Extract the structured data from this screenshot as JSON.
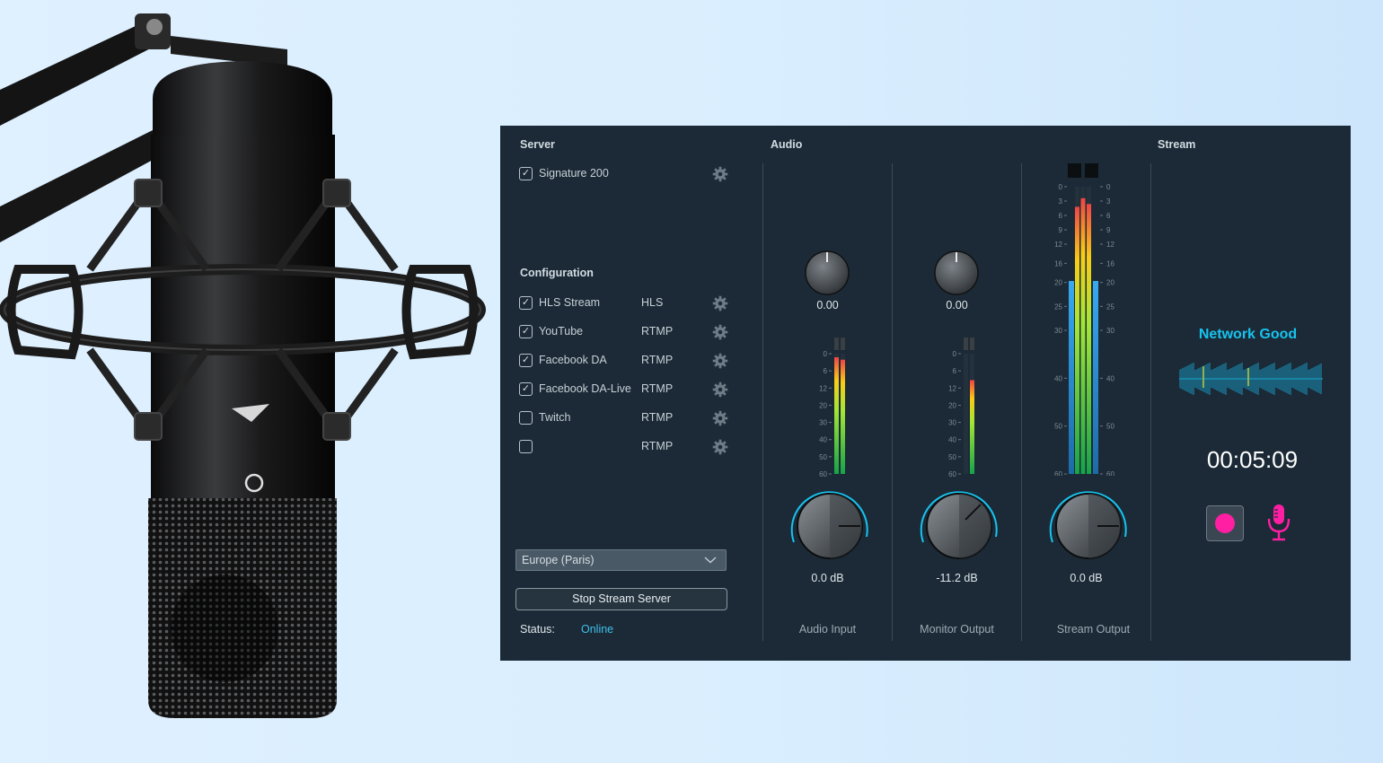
{
  "panel": {
    "sections": {
      "server": "Server",
      "audio": "Audio",
      "stream": "Stream",
      "configuration": "Configuration"
    },
    "server_item": {
      "label": "Signature 200",
      "checked": true
    },
    "configurations": [
      {
        "label": "HLS Stream",
        "protocol": "HLS",
        "checked": true
      },
      {
        "label": "YouTube",
        "protocol": "RTMP",
        "checked": true
      },
      {
        "label": "Facebook DA",
        "protocol": "RTMP",
        "checked": true
      },
      {
        "label": "Facebook DA-Live",
        "protocol": "RTMP",
        "checked": true
      },
      {
        "label": "Twitch",
        "protocol": "RTMP",
        "checked": false
      },
      {
        "label": "",
        "protocol": "RTMP",
        "checked": false
      }
    ],
    "region": {
      "value": "Europe (Paris)"
    },
    "stop_button": "Stop Stream Server",
    "status": {
      "label": "Status:",
      "value": "Online"
    }
  },
  "audio": {
    "channels": [
      {
        "name": "Audio Input",
        "pan": "0.00",
        "gain": "0.0 dB",
        "meter_scale": [
          "0",
          "6",
          "12",
          "20",
          "30",
          "40",
          "50",
          "60"
        ],
        "levels": [
          0.97,
          0.95
        ]
      },
      {
        "name": "Monitor Output",
        "pan": "0.00",
        "gain": "-11.2 dB",
        "meter_scale": [
          "0",
          "6",
          "12",
          "20",
          "30",
          "40",
          "50",
          "60"
        ],
        "levels": [
          0.0,
          0.78
        ]
      },
      {
        "name": "Stream Output",
        "gain": "0.0 dB",
        "meter_scale": [
          "0",
          "3",
          "6",
          "9",
          "12",
          "16",
          "20",
          "25",
          "30",
          "40",
          "50",
          "60"
        ],
        "levels": [
          0.93,
          0.96,
          0.94
        ]
      }
    ]
  },
  "stream": {
    "network_status": "Network Good",
    "timer": "00:05:09"
  },
  "colors": {
    "panel_bg": "#1b2a36",
    "accent_cyan": "#18c3ef",
    "record_pink": "#ff1fa2",
    "meter_low": "#22c55e",
    "meter_high": "#ef4444"
  },
  "icons": [
    "gear-icon",
    "chevron-down-icon",
    "record-icon",
    "microphone-icon",
    "checkmark-icon"
  ]
}
